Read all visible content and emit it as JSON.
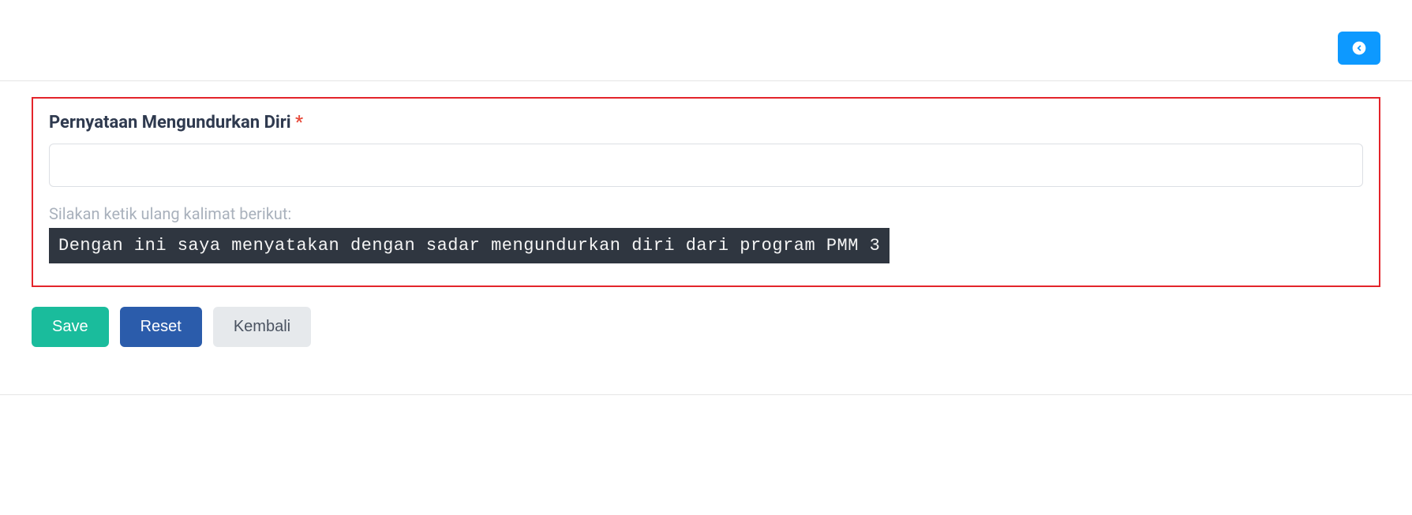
{
  "top": {
    "back_icon_name": "arrow-left-circle-icon"
  },
  "form": {
    "label": "Pernyataan Mengundurkan Diri",
    "required_mark": "*",
    "input_value": "",
    "helper_text": "Silakan ketik ulang kalimat berikut:",
    "statement_text": "Dengan ini saya menyatakan dengan sadar mengundurkan diri dari program PMM 3"
  },
  "buttons": {
    "save": "Save",
    "reset": "Reset",
    "back": "Kembali"
  }
}
